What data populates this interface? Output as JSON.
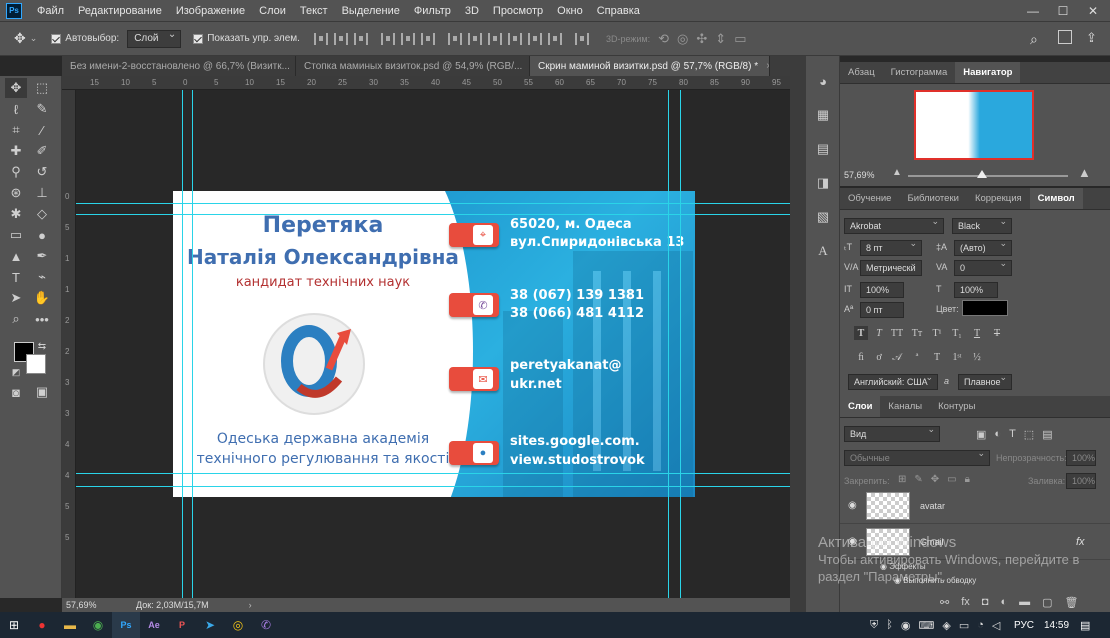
{
  "menu": {
    "items": [
      "Файл",
      "Редактирование",
      "Изображение",
      "Слои",
      "Текст",
      "Выделение",
      "Фильтр",
      "3D",
      "Просмотр",
      "Окно",
      "Справка"
    ],
    "logo": "Ps"
  },
  "window": {
    "minimize": "—",
    "maximize": "☐",
    "close": "✕"
  },
  "options": {
    "autoselect_label": "Автовыбор:",
    "autoselect_value": "Слой",
    "show_controls_label": "Показать упр. элем.",
    "mode3d_label": "3D-режим:"
  },
  "tabs": [
    {
      "label": "Без имени-2-восстановлено @ 66,7% (Визитк...",
      "active": false
    },
    {
      "label": "Стопка маминых визиток.psd @ 54,9% (RGB/...",
      "active": false
    },
    {
      "label": "Скрин маминой визитки.psd @ 57,7% (RGB/8) *",
      "active": true
    }
  ],
  "tab_close": "×",
  "ruler_h": [
    "15",
    "10",
    "5",
    "0",
    "5",
    "10",
    "15",
    "20",
    "25",
    "30",
    "35",
    "40",
    "45",
    "50",
    "55",
    "60",
    "65",
    "70",
    "75",
    "80",
    "85",
    "90",
    "95"
  ],
  "ruler_v": [
    "0",
    "5",
    "1",
    "1",
    "2",
    "2",
    "3",
    "3",
    "4",
    "4",
    "5",
    "5"
  ],
  "card": {
    "surname": "Перетяка",
    "name": "Наталія Олександрівна",
    "title": "кандидат технічних наук",
    "org_line1": "Одеська державна академія",
    "org_line2": "технічного регулювання та якості",
    "address_line1": "65020, м. Одеса",
    "address_line2": "вул.Спиридонівська 13",
    "phone1": "38 (067) 139 1381",
    "phone2": "38 (066) 481 4112",
    "email_line1": "peretyakanat@",
    "email_line2": "ukr.net",
    "site_line1": "sites.google.com.",
    "site_line2": "view.studostrovok"
  },
  "status": {
    "zoom": "57,69%",
    "doc": "Док: 2,03М/15,7М"
  },
  "top_panel": {
    "tabs": [
      "Абзац",
      "Гистограмма",
      "Навигатор"
    ],
    "active": "Навигатор",
    "zoom": "57,69%"
  },
  "char_panel": {
    "tabs": [
      "Обучение",
      "Библиотеки",
      "Коррекция",
      "Символ"
    ],
    "active": "Символ",
    "font": "Akrobat",
    "style": "Black",
    "size": "8 пт",
    "leading": "(Авто)",
    "kerning": "Метрически",
    "tracking": "0",
    "vscale": "100%",
    "hscale": "100%",
    "baseline": "0 пт",
    "color_label": "Цвет:",
    "language": "Английский: США",
    "antialias": "Плавное",
    "aa_label": "a"
  },
  "layers_panel": {
    "tabs": [
      "Слои",
      "Каналы",
      "Контуры"
    ],
    "active": "Слои",
    "filter": "Вид",
    "blend": "Обычные",
    "opacity_label": "Непрозрачность:",
    "opacity": "100%",
    "lock_label": "Закрепить:",
    "fill_label": "Заливка:",
    "fill": "100%",
    "layers": [
      {
        "name": "avatar"
      },
      {
        "name": "Gmail"
      }
    ],
    "effects_label": "Эффекты",
    "stroke_label": "Выполнить обводку"
  },
  "watermark": {
    "line1": "Активация Windows",
    "line2": "Чтобы активировать Windows, перейдите в",
    "line3": "раздел \"Параметры\"."
  },
  "taskbar": {
    "lang": "РУС",
    "time": "14:59"
  },
  "colors": {
    "accent": "#31a8ff",
    "guide": "#2ad4e8",
    "card_blue": "#3f6eb0",
    "card_red": "#e84c3d"
  }
}
